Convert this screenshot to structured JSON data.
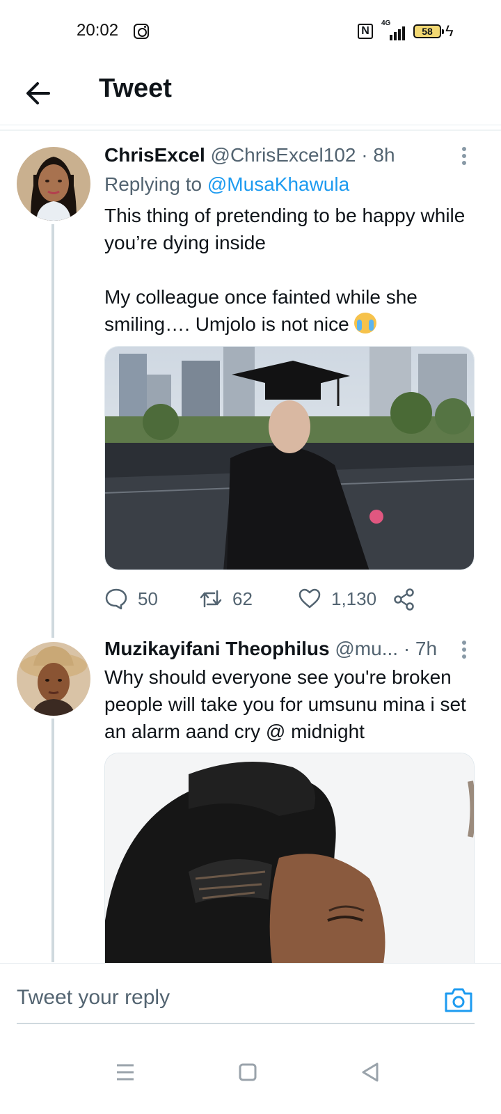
{
  "status_bar": {
    "time": "20:02",
    "network": "4G",
    "battery": "58",
    "icons": [
      "instagram-icon",
      "nfc-icon",
      "signal-icon",
      "battery-icon",
      "charging-icon"
    ]
  },
  "header": {
    "title": "Tweet",
    "back_icon": "back-arrow-icon"
  },
  "tweets": [
    {
      "name": "ChrisExcel",
      "handle": "@ChrisExcel102",
      "time": "· 8h",
      "replying_prefix": "Replying to",
      "replying_to": "@MusaKhawula",
      "text_p1": "This thing of pretending to be happy while you’re dying inside",
      "text_p2": "My colleague once fainted while she smiling…. Umjolo is not nice",
      "emoji": "loudly-crying-face",
      "stats": {
        "replies": "50",
        "retweets": "62",
        "likes": "1,130"
      }
    },
    {
      "name": "Muzikayifani Theophilus",
      "handle": "@mu...",
      "time": "· 7h",
      "text": "Why should everyone see you're broken people will take you for umsunu mina i set an alarm aand cry @ midnight"
    }
  ],
  "reply_bar": {
    "placeholder": "Tweet your reply",
    "icon": "camera-icon"
  },
  "nav_bar": {
    "icons": [
      "menu-icon",
      "home-square-icon",
      "back-triangle-icon"
    ]
  },
  "colors": {
    "accent": "#1d9bf0",
    "text": "#0f1419",
    "muted": "#536471",
    "thread_line": "#cfd9de"
  }
}
